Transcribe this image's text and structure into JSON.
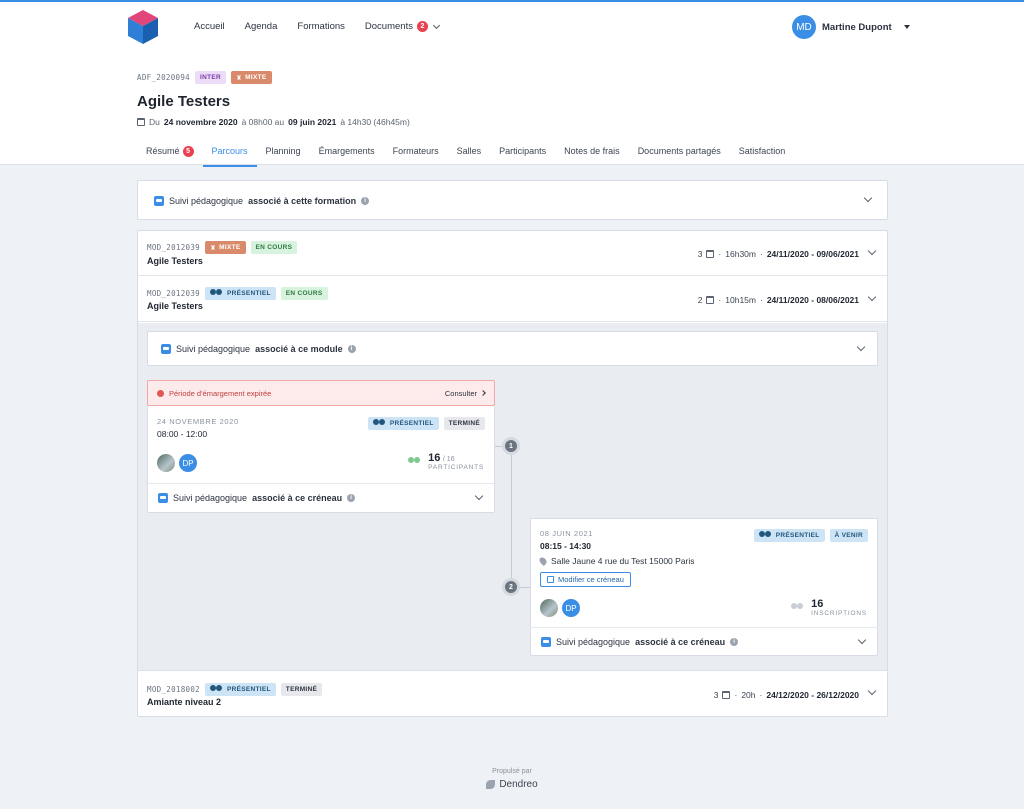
{
  "nav": {
    "items": [
      {
        "label": "Accueil"
      },
      {
        "label": "Agenda"
      },
      {
        "label": "Formations"
      },
      {
        "label": "Documents",
        "badge": "2"
      }
    ]
  },
  "user": {
    "initials": "MD",
    "name": "Martine Dupont"
  },
  "formation": {
    "code": "ADF_2020094",
    "tags": [
      "INTER",
      "MIXTE"
    ],
    "title": "Agile Testers",
    "dates": {
      "prefix": "Du",
      "start_date": "24 novembre 2020",
      "start_mid": "à 08h00 au",
      "end_date": "09 juin 2021",
      "end_rest": "à 14h30 (46h45m)"
    }
  },
  "tabs": [
    {
      "label": "Résumé",
      "badge": "5"
    },
    {
      "label": "Parcours",
      "active": true
    },
    {
      "label": "Planning"
    },
    {
      "label": "Émargements"
    },
    {
      "label": "Formateurs"
    },
    {
      "label": "Salles"
    },
    {
      "label": "Participants"
    },
    {
      "label": "Notes de frais"
    },
    {
      "label": "Documents partagés"
    },
    {
      "label": "Satisfaction"
    }
  ],
  "suivi_formation": {
    "text": "Suivi pédagogique",
    "bold": "associé à cette formation"
  },
  "modules": [
    {
      "code": "MOD_2012039",
      "tags": [
        "MIXTE",
        "EN COURS"
      ],
      "title": "Agile Testers",
      "count": "3",
      "duration": "16h30m",
      "range": "24/11/2020 - 09/06/2021"
    },
    {
      "code": "MOD_2012039",
      "tags": [
        "PRÉSENTIEL",
        "EN COURS"
      ],
      "title": "Agile Testers",
      "count": "2",
      "duration": "10h15m",
      "range": "24/11/2020 - 08/06/2021"
    },
    {
      "code": "MOD_2018002",
      "tags": [
        "PRÉSENTIEL",
        "TERMINÉ"
      ],
      "title": "Amiante niveau 2",
      "count": "3",
      "duration": "20h",
      "range": "24/12/2020 - 26/12/2020"
    }
  ],
  "separator": "·",
  "suivi_module": {
    "text": "Suivi pédagogique",
    "bold": "associé à ce module"
  },
  "expired": {
    "text": "Période d'émargement expirée",
    "action": "Consulter"
  },
  "slot1": {
    "step": "1",
    "date": "24 NOVEMBRE 2020",
    "time": "08:00 - 12:00",
    "tags": [
      "PRÉSENTIEL",
      "TERMINÉ"
    ],
    "avatar_initials": "DP",
    "count": "16",
    "total": "/ 16",
    "caption": "PARTICIPANTS",
    "suivi": {
      "text": "Suivi pédagogique",
      "bold": "associé à ce créneau"
    }
  },
  "slot2": {
    "step": "2",
    "date": "08 JUIN 2021",
    "time": "08:15 - 14:30",
    "tags": [
      "PRÉSENTIEL",
      "À VENIR"
    ],
    "location": "Salle Jaune 4 rue du Test 15000 Paris",
    "edit_label": "Modifier ce créneau",
    "avatar_initials": "DP",
    "count": "16",
    "caption": "INSCRIPTIONS",
    "suivi": {
      "text": "Suivi pédagogique",
      "bold": "associé à ce créneau"
    }
  },
  "footer": {
    "powered": "Propulsé par",
    "brand": "Dendreo"
  },
  "colors": {
    "accent": "#3a8ee6",
    "danger": "#e8414f",
    "mixte": "#d98a6a"
  }
}
